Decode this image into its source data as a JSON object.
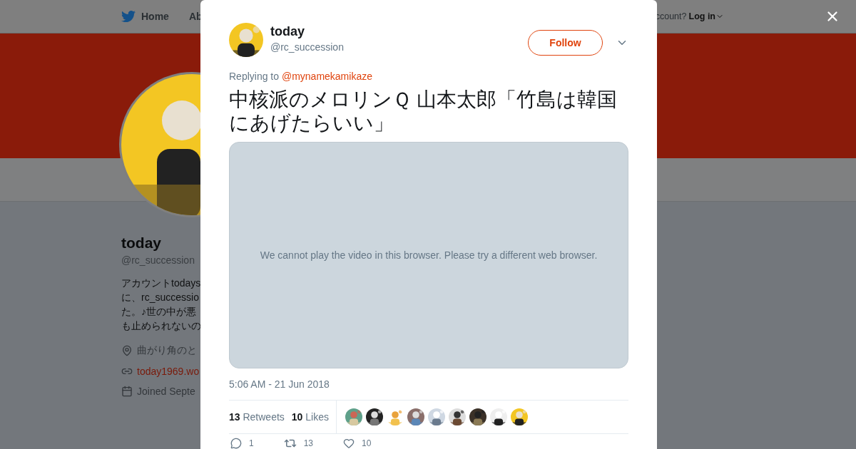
{
  "nav": {
    "items": [
      {
        "label": "Home",
        "kind": "home"
      },
      {
        "label": "Ab",
        "kind": "plain"
      }
    ],
    "login_prompt": "ccount?",
    "login": "Log in"
  },
  "profile": {
    "name": "today",
    "handle": "@rc_succession",
    "bio": [
      "アカウントtodays",
      "に、rc_successio",
      "た。♪世の中が悪",
      "も止められないの"
    ],
    "location": "曲がり角のと",
    "website": "today1969.wo",
    "joined": "Joined Septe"
  },
  "tweet": {
    "name": "today",
    "handle": "@rc_succession",
    "follow": "Follow",
    "replying_label": "Replying to",
    "replying_to": "@mynamekamikaze",
    "text": "中核派のメロリンＱ 山本太郎「竹島は韓国にあげたらいい」",
    "video_message": "We cannot play the video in this browser. Please try a different web browser.",
    "timestamp": "5:06 AM - 21 Jun 2018",
    "stats": [
      {
        "count": "13",
        "label": "Retweets"
      },
      {
        "count": "10",
        "label": "Likes"
      }
    ],
    "actions": [
      {
        "kind": "reply",
        "count": "1"
      },
      {
        "kind": "retweet",
        "count": "13"
      },
      {
        "kind": "like",
        "count": "10"
      }
    ]
  }
}
